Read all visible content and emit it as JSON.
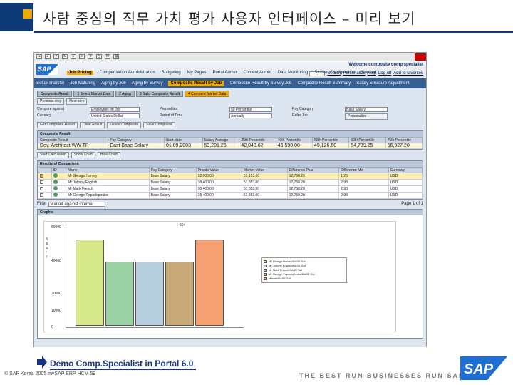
{
  "slide": {
    "title": "사람 중심의 직무 가치 평가 사용자 인터페이스 – 미리 보기"
  },
  "portal": {
    "welcome": "Welcome composite comp specialist",
    "header_links": [
      "Search",
      "Personalize",
      "Help",
      "Log off",
      "Add to favorites"
    ],
    "logo": "SAP",
    "nav1": [
      "Job Pricing",
      "Compensation Administration",
      "Budgeting",
      "My Pages",
      "Portal Admin",
      "Content Admin",
      "Data Monitoring",
      "System Configuration",
      "Support"
    ],
    "nav2": [
      "Setup Transfer",
      "Job Matching",
      "Aging by Job",
      "Aging by Survey",
      "Composite Result by Job",
      "Composite Result by Survey Job",
      "Composite Result Summary",
      "Salary Structure Adjustment"
    ],
    "roadmap": [
      "Composite Result",
      "1 Select Market Data",
      "2 Aging",
      "3 Build Composite Result",
      "4 Compare Market Data"
    ],
    "buttons1": [
      "Previous step",
      "Next step"
    ],
    "form": {
      "comparison_label": "Compare against",
      "comparison_value": "Employees on Job",
      "currency_label": "Currency",
      "currency_value": "United States Dollar",
      "percentile_label": "Percentiles",
      "percentile_value": "50 Percentile",
      "time_label": "Period of Time",
      "time_value": "Annually",
      "paycat_label": "Pay Category",
      "paycat_value": "Base Salary",
      "refer_label": "Refer Job",
      "refer_btn": "Personalize"
    },
    "buttons2": [
      "Get Composite Result",
      "Clear Result",
      "Delete Composite",
      "Save Composite"
    ],
    "composite": {
      "header": "Composite Result",
      "columns": [
        "Composite Result",
        "Pay Category",
        "Start date",
        "Salary Average",
        "25th Percentile",
        "40th Percentile",
        "50th Percentile",
        "60th Percentile",
        "75th Percentile"
      ],
      "row": [
        "Dev. Architect WW TP",
        "East Base Salary",
        "01.09.2003",
        "53,291.25",
        "42,043.62",
        "46,590.00",
        "49,126.60",
        "54,739.25",
        "56,927.20"
      ],
      "paging": "Page 1 of 1"
    },
    "buttons3": [
      "Start Calculation",
      "Show Chart",
      "Hide Chart"
    ],
    "results": {
      "header": "Results of Comparison",
      "columns": [
        "",
        "ID",
        "Name",
        "Pay Category",
        "Private Value",
        "Market Value",
        "Difference Plus",
        "Difference Min",
        "Currency"
      ],
      "rows": [
        [
          "✓",
          "",
          "Mr George Harvey",
          "Base Salary",
          "52,000.00",
          "51,153.00",
          "12,750.20",
          "1.26",
          "USD"
        ],
        [
          "",
          "",
          "Mr Johnny English",
          "Base Salary",
          "38,400.00",
          "51,853.00",
          "12,750.20",
          "2.93",
          "USD"
        ],
        [
          "",
          "",
          "Mr Mark French",
          "Base Salary",
          "38,400.00",
          "51,853.00",
          "12,750.20",
          "2.93",
          "USD"
        ],
        [
          "",
          "",
          "Mr George Papadopoulos",
          "Base Salary",
          "38,400.00",
          "51,853.00",
          "12,750.20",
          "2.93",
          "USD"
        ]
      ]
    },
    "filter": {
      "label": "Filter",
      "value": "Market against internal"
    },
    "graphic": {
      "header": "Graphic",
      "ylabel": "Salary",
      "title": "504",
      "ytick_labels": [
        "60000",
        "40000",
        "20000",
        "10000",
        "0"
      ]
    },
    "paging_lower": "Page 1 of 1"
  },
  "chart_data": {
    "type": "bar",
    "title": "504",
    "xlabel": "",
    "ylabel": "Salary",
    "ylim": [
      0,
      60000
    ],
    "categories": [
      "Mr George Harvey/Base Sal",
      "Mr Johnny English/Base Sal",
      "Mr Mark French/Base Sal",
      "Mr George Papadopoulos/Base Sal",
      "Market"
    ],
    "values": [
      52000,
      38400,
      38400,
      38400,
      51853
    ],
    "colors": [
      "#d8e98c",
      "#9cd0a5",
      "#b8cfe0",
      "#c8aa78",
      "#f5a070"
    ],
    "legend": [
      "Mr George Harvey/BASE Sal",
      "Mr Johnny English/BASE Sal",
      "Mr Mark French/BASE Sal",
      "Mr George Papadopoulos/BASE Sal",
      "Market/BASE Sal"
    ]
  },
  "footer": {
    "demo": "Demo Comp.Specialist in Portal 6.0",
    "copyright": "© SAP Korea 2005",
    "product": "mySAP ERP HCM",
    "page": "59",
    "tagline": "THE BEST-RUN BUSINESSES RUN SAP",
    "logo": "SAP"
  },
  "colors": {
    "brand_blue": "#0f3a78",
    "accent": "#f2a900",
    "sap_blue": "#1e6fd1"
  }
}
